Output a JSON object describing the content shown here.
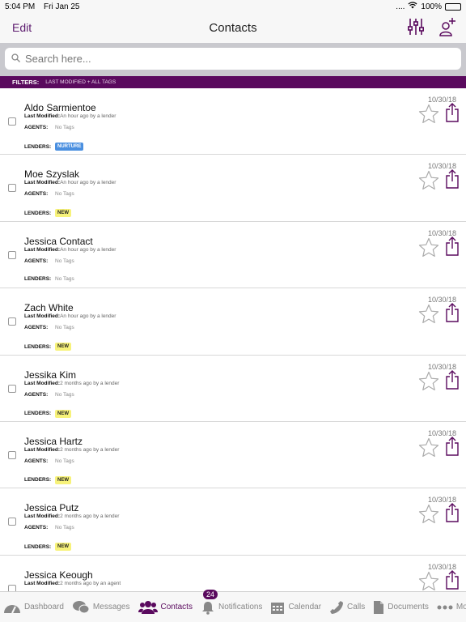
{
  "status": {
    "time": "5:04 PM",
    "date": "Fri Jan 25",
    "signal": "....",
    "battery": "100%",
    "battery_level": 1.0
  },
  "nav": {
    "edit": "Edit",
    "title": "Contacts"
  },
  "search": {
    "placeholder": "Search here..."
  },
  "filters": {
    "label": "FILTERS:",
    "value": "LAST MODIFIED + ALL TAGS"
  },
  "labels": {
    "last_modified": "Last Modified:",
    "agents": "AGENTS:",
    "lenders": "LENDERS:",
    "no_tags": "No Tags"
  },
  "contacts": [
    {
      "name": "Aldo Sarmientoe",
      "modified": "An hour ago by a lender",
      "date": "10/30/18",
      "agents": "No Tags",
      "lender_tag": "NURTURE",
      "lender_tag_type": "nurture"
    },
    {
      "name": "Moe Szyslak",
      "modified": "An hour ago by a lender",
      "date": "10/30/18",
      "agents": "No Tags",
      "lender_tag": "NEW",
      "lender_tag_type": "new"
    },
    {
      "name": "Jessica Contact",
      "modified": "An hour ago by a lender",
      "date": "10/30/18",
      "agents": "No Tags",
      "lender_tag": "No Tags",
      "lender_tag_type": "none"
    },
    {
      "name": "Zach White",
      "modified": "An hour ago by a lender",
      "date": "10/30/18",
      "agents": "No Tags",
      "lender_tag": "NEW",
      "lender_tag_type": "new"
    },
    {
      "name": "Jessika Kim",
      "modified": "2 months ago by a lender",
      "date": "10/30/18",
      "agents": "No Tags",
      "lender_tag": "NEW",
      "lender_tag_type": "new"
    },
    {
      "name": "Jessica Hartz",
      "modified": "2 months ago by a lender",
      "date": "10/30/18",
      "agents": "No Tags",
      "lender_tag": "NEW",
      "lender_tag_type": "new"
    },
    {
      "name": "Jessica Putz",
      "modified": "2 months ago by a lender",
      "date": "10/30/18",
      "agents": "No Tags",
      "lender_tag": "NEW",
      "lender_tag_type": "new"
    },
    {
      "name": "Jessica Keough",
      "modified": "2 months ago by an agent",
      "date": "10/30/18",
      "agents": "",
      "lender_tag": "",
      "lender_tag_type": "hidden"
    }
  ],
  "tabs": [
    {
      "label": "Dashboard",
      "icon": "dashboard-icon",
      "active": false
    },
    {
      "label": "Messages",
      "icon": "messages-icon",
      "active": false
    },
    {
      "label": "Contacts",
      "icon": "contacts-icon",
      "active": true
    },
    {
      "label": "Notifications",
      "icon": "bell-icon",
      "active": false,
      "badge": "24"
    },
    {
      "label": "Calendar",
      "icon": "calendar-icon",
      "active": false
    },
    {
      "label": "Calls",
      "icon": "phone-icon",
      "active": false
    },
    {
      "label": "Documents",
      "icon": "document-icon",
      "active": false
    },
    {
      "label": "More",
      "icon": "more-icon",
      "active": false
    }
  ],
  "colors": {
    "accent": "#5a0a5e",
    "nurture": "#4a8fe0",
    "new": "#f7f27a"
  }
}
